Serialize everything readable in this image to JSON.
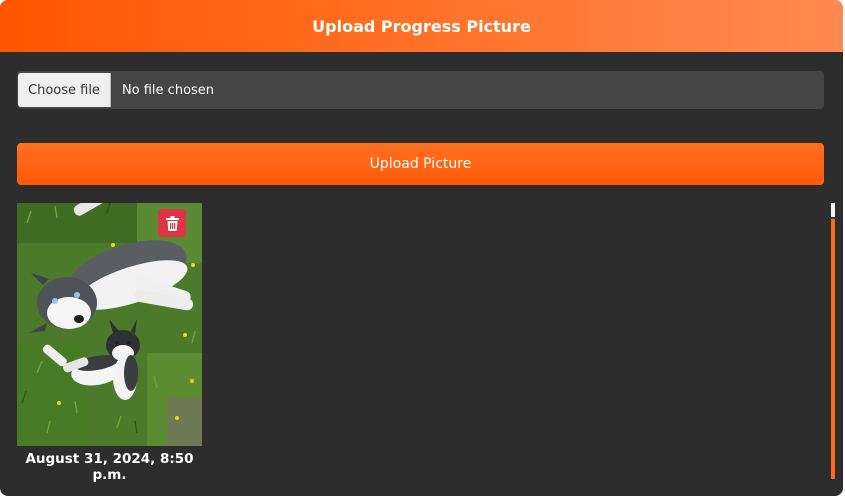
{
  "header": {
    "title": "Upload Progress Picture"
  },
  "file_input": {
    "button_label": "Choose file",
    "status": "No file chosen"
  },
  "upload_button": {
    "label": "Upload Picture"
  },
  "photos": [
    {
      "date": "August 31, 2024, 8:50 p.m.",
      "delete_icon": "trash-icon"
    }
  ],
  "colors": {
    "accent": "#ff5a08",
    "background": "#2d2d2d",
    "delete": "#dc3545"
  }
}
